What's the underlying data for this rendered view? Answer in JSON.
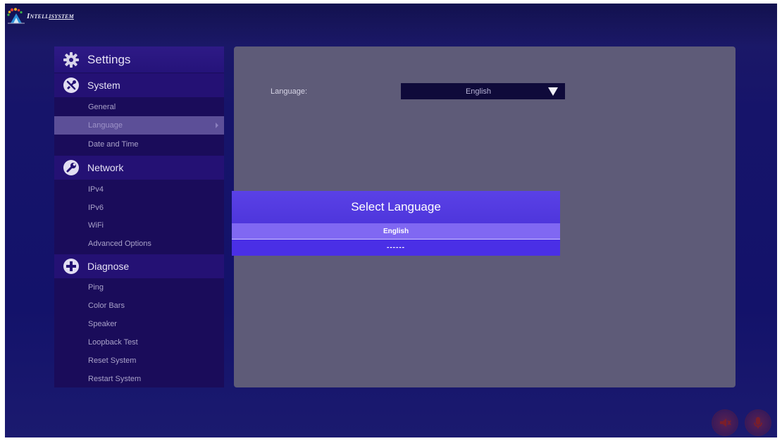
{
  "brand": {
    "name_lead": "Intell",
    "name_tail": "isystem",
    "logo_icon": "intellisystem-logo-icon"
  },
  "sidebar": {
    "header": {
      "label": "Settings",
      "icon": "gear-icon"
    },
    "sections": [
      {
        "label": "System",
        "icon": "tools-icon",
        "items": [
          "General",
          "Language",
          "Date and Time"
        ]
      },
      {
        "label": "Network",
        "icon": "wrench-icon",
        "items": [
          "IPv4",
          "IPv6",
          "WiFi",
          "Advanced Options"
        ]
      },
      {
        "label": "Diagnose",
        "icon": "plus-icon",
        "items": [
          "Ping",
          "Color Bars",
          "Speaker",
          "Loopback Test",
          "Reset System",
          "Restart System"
        ]
      }
    ],
    "selected_item": "Language"
  },
  "content": {
    "language_label": "Language:",
    "language_value": "English",
    "dropdown_icon": "triangle-down-icon"
  },
  "dialog": {
    "title": "Select Language",
    "options": [
      "English",
      "------"
    ],
    "selected_option": "English"
  },
  "footer_buttons": [
    {
      "icon": "mute-icon"
    },
    {
      "icon": "mic-icon"
    }
  ],
  "colors": {
    "background": "#16146a",
    "sidebar": "#1a0c5a",
    "sidebar_category": "#241174",
    "selected_item": "#5c4f98",
    "content_panel": "#5e5b78",
    "dialog_title": "#5a41e6",
    "dialog_selected": "#8068f2",
    "dialog_option": "#4a2fe6"
  }
}
